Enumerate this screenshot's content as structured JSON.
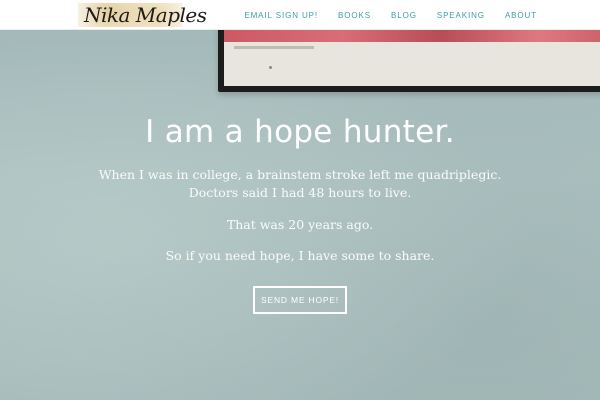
{
  "brand": {
    "logo_text": "Nika Maples"
  },
  "nav": {
    "items": [
      {
        "label": "EMAIL SIGN UP!"
      },
      {
        "label": "BOOKS"
      },
      {
        "label": "BLOG"
      },
      {
        "label": "SPEAKING"
      },
      {
        "label": "ABOUT"
      }
    ]
  },
  "hero": {
    "title": "I am a hope hunter.",
    "line1": "When I was in college, a brainstem stroke left me quadriplegic.",
    "line2": "Doctors said I had 48 hours to live.",
    "line3": "That was 20 years ago.",
    "line4": "So if you need hope, I have some to share.",
    "cta_label": "SEND ME HOPE!"
  },
  "colors": {
    "nav_link": "#3e9ea3",
    "hero_background": "#a9bfbf",
    "hero_text": "#ffffff"
  }
}
